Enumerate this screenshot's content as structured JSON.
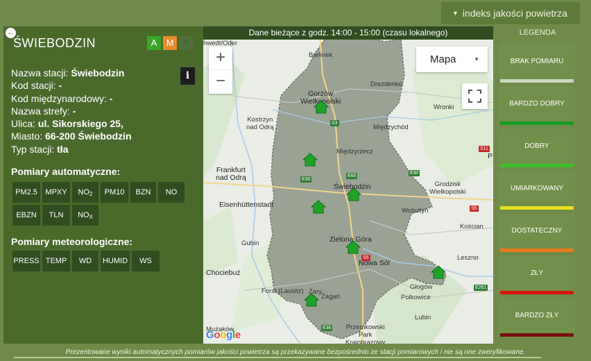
{
  "header": {
    "index_toggle": "indeks jakości powietrza",
    "map_header": "Dane bieżące z godz. 14:00 - 15:00 (czasu lokalnego)"
  },
  "station": {
    "title": "ŚWIEBODZIN",
    "index_buttons": [
      "A",
      "M",
      "P"
    ],
    "info_label": "i",
    "details": [
      {
        "label": "Nazwa stacji:",
        "value": "Świebodzin"
      },
      {
        "label": "Kod stacji:",
        "value": "-"
      },
      {
        "label": "Kod międzynarodowy:",
        "value": "-"
      },
      {
        "label": "Nazwa strefy:",
        "value": "-"
      },
      {
        "label": "Ulica:",
        "value": "ul. Sikorskiego 25,"
      },
      {
        "label": "Miasto:",
        "value": "66-200 Świebodzin"
      },
      {
        "label": "Typ stacji:",
        "value": "tła"
      }
    ],
    "auto_heading": "Pomiary automatyczne:",
    "auto_buttons": [
      {
        "base": "PM2.5",
        "sub": ""
      },
      {
        "base": "MPXY",
        "sub": ""
      },
      {
        "base": "NO",
        "sub": "2"
      },
      {
        "base": "PM10",
        "sub": ""
      },
      {
        "base": "BZN",
        "sub": ""
      },
      {
        "base": "NO",
        "sub": ""
      },
      {
        "base": "EBZN",
        "sub": ""
      },
      {
        "base": "TLN",
        "sub": ""
      },
      {
        "base": "NO",
        "sub": "X"
      }
    ],
    "meteo_heading": "Pomiary meteorologiczne:",
    "meteo_buttons": [
      "PRESS",
      "TEMP",
      "WD",
      "HUMID",
      "WS"
    ]
  },
  "map": {
    "zoom_in": "+",
    "zoom_out": "−",
    "type_label": "Mapa",
    "google_letters": [
      "G",
      "o",
      "o",
      "g",
      "l",
      "e"
    ],
    "google_colors": [
      "#4285f4",
      "#ea4335",
      "#fbbc05",
      "#4285f4",
      "#34a853",
      "#ea4335"
    ],
    "cities": [
      "hwedt/Oder",
      "Barlinek",
      "Gorzów\nWielkopolski",
      "Drezdenko",
      "Kostrzyn\nnad Odrą",
      "Wronki",
      "Międzychód",
      "Międzyrzecz",
      "Frankfurt\nnad Odrą",
      "Świebodzin",
      "Grodzisk\nWielkopolski",
      "Eisenhüttenstadt",
      "Wolsztyn",
      "Kościan",
      "Zielona Góra",
      "Gubin",
      "Nowa Sól",
      "Leszno",
      "Chociebuż",
      "Głogów",
      "Forst (Lausitz)",
      "Żary",
      "Żagań",
      "Polkowice",
      "Lubin",
      "Mużaków",
      "Przemkowski\nPark\nKrajobrazowy",
      "P"
    ],
    "road_signs": [
      "S3",
      "S3",
      "E65",
      "E30",
      "S11",
      "S5",
      "S5",
      "E30",
      "E261",
      "E36"
    ],
    "stations_count": 7
  },
  "legend": {
    "title": "LEGENDA",
    "items": [
      {
        "label": "BRAK POMIARU",
        "color": "#c9d6c0"
      },
      {
        "label": "BARDZO DOBRY",
        "color": "#149b25"
      },
      {
        "label": "DOBRY",
        "color": "#3ac02c"
      },
      {
        "label": "UMIARKOWANY",
        "color": "#e8e01c"
      },
      {
        "label": "DOSTATECZNY",
        "color": "#e87a1d"
      },
      {
        "label": "ZŁY",
        "color": "#d8160f"
      },
      {
        "label": "BARDZO ZŁY",
        "color": "#7a0f12"
      }
    ]
  },
  "footer": {
    "note": "Prezentowane wyniki automatycznych pomiarów jakości powietrza są przekazywane bezpośrednio ze stacji pomiarowych i nie są one zweryfikowane."
  },
  "colors": {
    "panel_bg": "#4a6a2c",
    "page_bg": "#6f8a4a",
    "button_bg": "#2f4d1f",
    "station_marker": "#1fa327",
    "region_fill": "#9aa294"
  }
}
